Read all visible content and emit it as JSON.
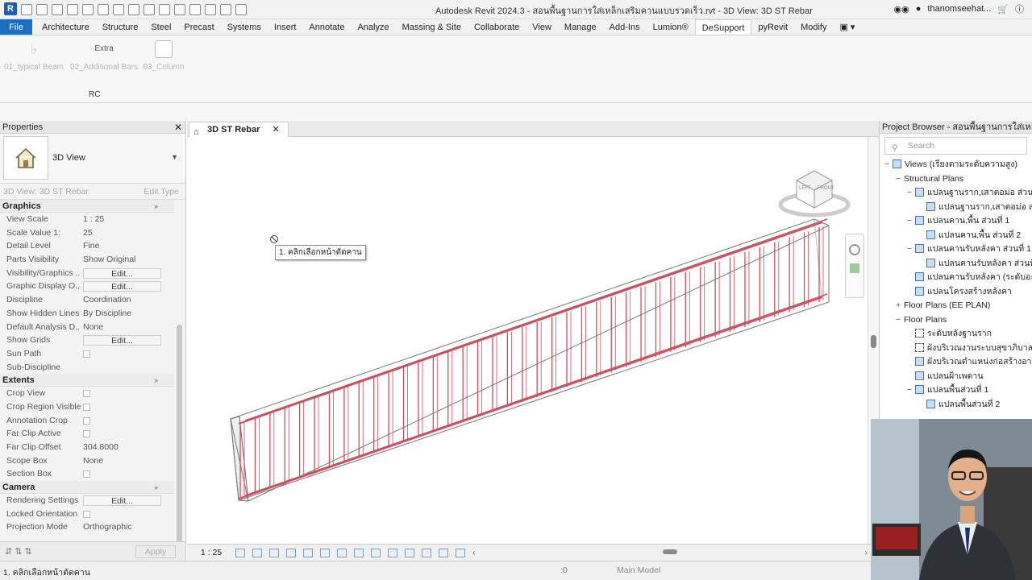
{
  "titlebar": {
    "logo": "R",
    "title": "Autodesk Revit 2024.3 - สอนพื้นฐานการใส่เหล็กเสริมคานแบบรวดเร็ว.rvt - 3D View: 3D ST Rebar",
    "username": "thanomseehat..."
  },
  "tabs": [
    "Architecture",
    "Structure",
    "Steel",
    "Precast",
    "Systems",
    "Insert",
    "Annotate",
    "Analyze",
    "Massing & Site",
    "Collaborate",
    "View",
    "Manage",
    "Add-Ins",
    "Lumion®",
    "DeSupport",
    "pyRevit",
    "Modify"
  ],
  "file_tab": "File",
  "active_tab": "DeSupport",
  "ribbon": {
    "buttons": [
      {
        "label": "01_typical Beam"
      },
      {
        "label": "02_Additional Bars",
        "top_label": "Extra"
      },
      {
        "label": "03_Column"
      }
    ],
    "panel_label": "RC"
  },
  "properties": {
    "header": "Properties",
    "type_name": "3D View",
    "instance": "3D View: 3D ST Rebar",
    "edit_type": "Edit Type",
    "sections": [
      {
        "title": "Graphics",
        "rows": [
          {
            "k": "View Scale",
            "v": "1 : 25"
          },
          {
            "k": "Scale Value    1:",
            "v": "25"
          },
          {
            "k": "Detail Level",
            "v": "Fine"
          },
          {
            "k": "Parts Visibility",
            "v": "Show Original"
          },
          {
            "k": "Visibility/Graphics ...",
            "btn": "Edit..."
          },
          {
            "k": "Graphic Display O...",
            "btn": "Edit..."
          },
          {
            "k": "Discipline",
            "v": "Coordination"
          },
          {
            "k": "Show Hidden Lines",
            "v": "By Discipline"
          },
          {
            "k": "Default Analysis D...",
            "v": "None"
          },
          {
            "k": "Show Grids",
            "btn": "Edit..."
          },
          {
            "k": "Sun Path",
            "chk": true
          },
          {
            "k": "Sub-Discipline",
            "v": ""
          }
        ]
      },
      {
        "title": "Extents",
        "rows": [
          {
            "k": "Crop View",
            "chk": true
          },
          {
            "k": "Crop Region Visible",
            "chk": true
          },
          {
            "k": "Annotation Crop",
            "chk": true
          },
          {
            "k": "Far Clip Active",
            "chk": true
          },
          {
            "k": "Far Clip Offset",
            "v": "304.8000"
          },
          {
            "k": "Scope Box",
            "v": "None"
          },
          {
            "k": "Section Box",
            "chk": true
          }
        ]
      },
      {
        "title": "Camera",
        "rows": [
          {
            "k": "Rendering Settings",
            "btn": "Edit..."
          },
          {
            "k": "Locked Orientation",
            "chk": true
          },
          {
            "k": "Projection Mode",
            "v": "Orthographic"
          }
        ]
      }
    ],
    "apply": "Apply"
  },
  "view": {
    "tab_title": "3D ST Rebar",
    "tooltip": "1. คลิกเลือกหน้าตัดคาน",
    "viewcube_left": "LEFT",
    "viewcube_front": "FRONT",
    "scale": "1 : 25",
    "stirrup_count": 40
  },
  "browser": {
    "header": "Project Browser - สอนพื้นฐานการใส่เหล็กเสริ",
    "search_placeholder": "Search",
    "items": [
      {
        "indent": 0,
        "toggle": "−",
        "icon": "views",
        "label": "Views (เรียงตามระดับความสูง)"
      },
      {
        "indent": 1,
        "toggle": "−",
        "label": "Structural Plans"
      },
      {
        "indent": 2,
        "toggle": "−",
        "icon": "sq",
        "label": "แปลนฐานราก,เสาตอม่อ ส่วนที่"
      },
      {
        "indent": 3,
        "icon": "sq",
        "label": "แปลนฐานราก,เสาตอม่อ ส่"
      },
      {
        "indent": 2,
        "toggle": "−",
        "icon": "sq",
        "label": "แปลนคาน,พื้น ส่วนที่ 1"
      },
      {
        "indent": 3,
        "icon": "sq",
        "label": "แปลนคาน,พื้น ส่วนที่ 2"
      },
      {
        "indent": 2,
        "toggle": "−",
        "icon": "sq",
        "label": "แปลนคานรับหลังคา ส่วนที่ 1"
      },
      {
        "indent": 3,
        "icon": "sq",
        "label": "แปลนคานรับหลังคา ส่วนที่"
      },
      {
        "indent": 2,
        "icon": "sq",
        "label": "แปลนคานรับหลังคา (ระดับอะ"
      },
      {
        "indent": 2,
        "icon": "sq",
        "label": "แปลนโครงสร้างหลังคา"
      },
      {
        "indent": 1,
        "toggle": "+",
        "label": "Floor Plans (EE PLAN)"
      },
      {
        "indent": 1,
        "toggle": "−",
        "label": "Floor Plans"
      },
      {
        "indent": 2,
        "icon": "sqo",
        "label": "ระดับหลังฐานราก"
      },
      {
        "indent": 2,
        "icon": "sqo",
        "label": "ผังบริเวณงานระบบสุขาภิบาล"
      },
      {
        "indent": 2,
        "icon": "sq",
        "label": "ผังบริเวณตำแหน่งก่อสร้างอาค"
      },
      {
        "indent": 2,
        "icon": "sq",
        "label": "แปลนฝ้าเพดาน"
      },
      {
        "indent": 2,
        "toggle": "−",
        "icon": "sq",
        "label": "แปลนพื้นส่วนที่ 1"
      },
      {
        "indent": 3,
        "icon": "sq",
        "label": "แปลนพื้นส่วนที่ 2"
      }
    ]
  },
  "status": {
    "text": "1. คลิกเลือกหน้าตัดคาน",
    "zero": ":0",
    "model": "Main Model"
  },
  "colors": {
    "file_tab": "#1b6fc2",
    "rebar": "#c8505f"
  }
}
